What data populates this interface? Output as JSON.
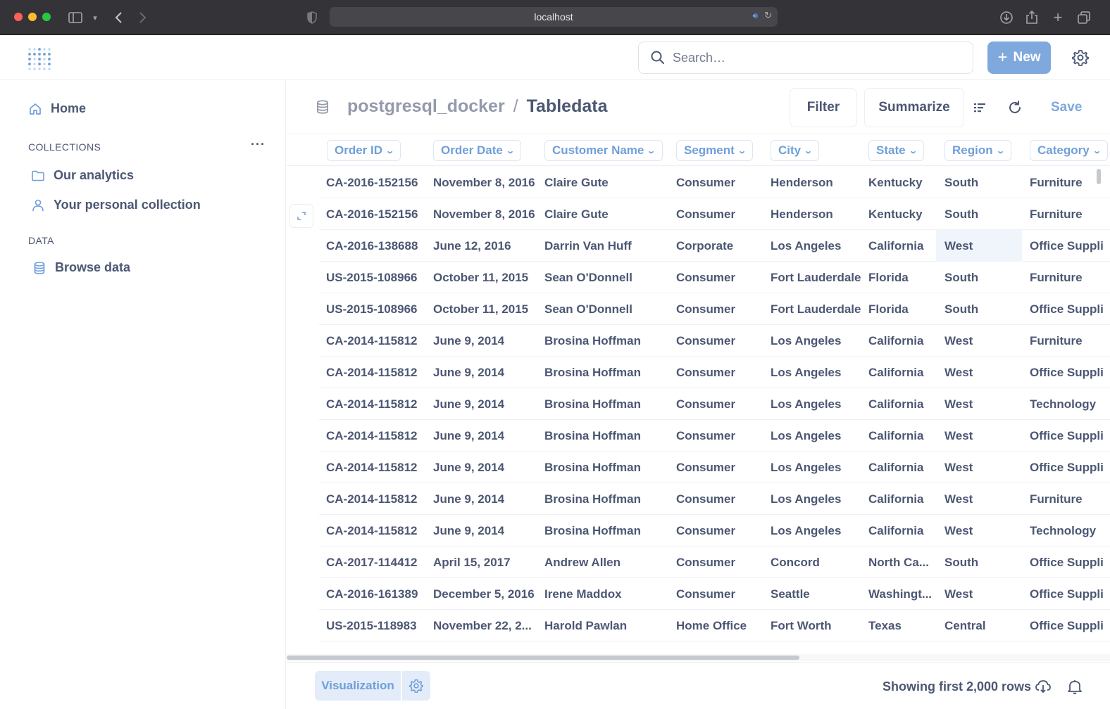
{
  "browser": {
    "url": "localhost"
  },
  "header": {
    "search_placeholder": "Search…",
    "new_label": "New"
  },
  "sidebar": {
    "home": "Home",
    "collections_heading": "COLLECTIONS",
    "collections": [
      "Our analytics",
      "Your personal collection"
    ],
    "data_heading": "DATA",
    "browse": "Browse data"
  },
  "query": {
    "database": "postgresql_docker",
    "separator": "/",
    "table": "Tabledata",
    "filter_label": "Filter",
    "summarize_label": "Summarize",
    "save_label": "Save"
  },
  "table": {
    "columns": [
      "Order ID",
      "Order Date",
      "Customer Name",
      "Segment",
      "City",
      "State",
      "Region",
      "Category"
    ],
    "rows": [
      [
        "CA-2016-152156",
        "November 8, 2016",
        "Claire Gute",
        "Consumer",
        "Henderson",
        "Kentucky",
        "South",
        "Furniture"
      ],
      [
        "CA-2016-152156",
        "November 8, 2016",
        "Claire Gute",
        "Consumer",
        "Henderson",
        "Kentucky",
        "South",
        "Furniture"
      ],
      [
        "CA-2016-138688",
        "June 12, 2016",
        "Darrin Van Huff",
        "Corporate",
        "Los Angeles",
        "California",
        "West",
        "Office Suppli"
      ],
      [
        "US-2015-108966",
        "October 11, 2015",
        "Sean O'Donnell",
        "Consumer",
        "Fort Lauderdale",
        "Florida",
        "South",
        "Furniture"
      ],
      [
        "US-2015-108966",
        "October 11, 2015",
        "Sean O'Donnell",
        "Consumer",
        "Fort Lauderdale",
        "Florida",
        "South",
        "Office Suppli"
      ],
      [
        "CA-2014-115812",
        "June 9, 2014",
        "Brosina Hoffman",
        "Consumer",
        "Los Angeles",
        "California",
        "West",
        "Furniture"
      ],
      [
        "CA-2014-115812",
        "June 9, 2014",
        "Brosina Hoffman",
        "Consumer",
        "Los Angeles",
        "California",
        "West",
        "Office Suppli"
      ],
      [
        "CA-2014-115812",
        "June 9, 2014",
        "Brosina Hoffman",
        "Consumer",
        "Los Angeles",
        "California",
        "West",
        "Technology"
      ],
      [
        "CA-2014-115812",
        "June 9, 2014",
        "Brosina Hoffman",
        "Consumer",
        "Los Angeles",
        "California",
        "West",
        "Office Suppli"
      ],
      [
        "CA-2014-115812",
        "June 9, 2014",
        "Brosina Hoffman",
        "Consumer",
        "Los Angeles",
        "California",
        "West",
        "Office Suppli"
      ],
      [
        "CA-2014-115812",
        "June 9, 2014",
        "Brosina Hoffman",
        "Consumer",
        "Los Angeles",
        "California",
        "West",
        "Furniture"
      ],
      [
        "CA-2014-115812",
        "June 9, 2014",
        "Brosina Hoffman",
        "Consumer",
        "Los Angeles",
        "California",
        "West",
        "Technology"
      ],
      [
        "CA-2017-114412",
        "April 15, 2017",
        "Andrew Allen",
        "Consumer",
        "Concord",
        "North Ca...",
        "South",
        "Office Suppli"
      ],
      [
        "CA-2016-161389",
        "December 5, 2016",
        "Irene Maddox",
        "Consumer",
        "Seattle",
        "Washingt...",
        "West",
        "Office Suppli"
      ],
      [
        "US-2015-118983",
        "November 22, 2...",
        "Harold Pawlan",
        "Home Office",
        "Fort Worth",
        "Texas",
        "Central",
        "Office Suppli"
      ]
    ],
    "highlighted_cell": {
      "row": 2,
      "col": 6
    }
  },
  "footer": {
    "visualization_label": "Visualization",
    "row_count": "Showing first 2,000 rows"
  }
}
